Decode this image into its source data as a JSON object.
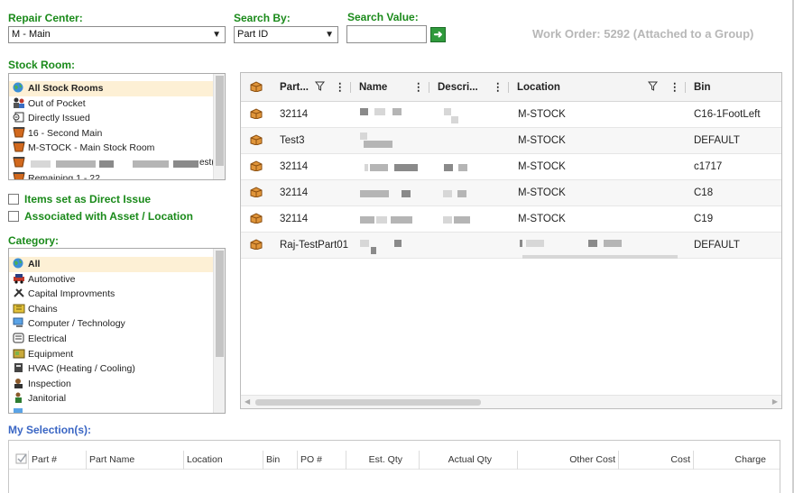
{
  "filters": {
    "repair_center_label": "Repair Center:",
    "repair_center_value": "M - Main",
    "search_by_label": "Search By:",
    "search_by_value": "Part ID",
    "search_value_label": "Search Value:",
    "search_value_input": "",
    "go_icon": "arrow-right-icon"
  },
  "work_order_text": "Work Order: 5292 (Attached to a Group)",
  "stock_room": {
    "label": "Stock Room:",
    "items": [
      {
        "label": "All Stock Rooms",
        "icon": "globe-icon",
        "selected": true
      },
      {
        "label": "Out of Pocket",
        "icon": "people-icon"
      },
      {
        "label": "Directly Issued",
        "icon": "document-icon"
      },
      {
        "label": "16 - Second Main",
        "icon": "bin-icon"
      },
      {
        "label": "M-STOCK - Main Stock Room",
        "icon": "bin-icon"
      },
      {
        "label": "",
        "icon": "bin-icon"
      },
      {
        "label": "Remaining 1 - 22",
        "icon": "bin-icon"
      }
    ],
    "tail_text": "est("
  },
  "options": {
    "direct_issue_label": "Items set as Direct Issue",
    "direct_issue_checked": false,
    "associated_label": "Associated with Asset / Location",
    "associated_checked": false
  },
  "category": {
    "label": "Category:",
    "items": [
      {
        "label": "All",
        "icon": "globe-icon",
        "selected": true
      },
      {
        "label": "Automotive",
        "icon": "car-icon"
      },
      {
        "label": "Capital Improvments",
        "icon": "tools-icon"
      },
      {
        "label": "Chains",
        "icon": "chain-icon"
      },
      {
        "label": "Computer / Technology",
        "icon": "computer-icon"
      },
      {
        "label": "Electrical",
        "icon": "electrical-icon"
      },
      {
        "label": "Equipment",
        "icon": "equipment-icon"
      },
      {
        "label": "HVAC (Heating / Cooling)",
        "icon": "hvac-icon"
      },
      {
        "label": "Inspection",
        "icon": "inspection-icon"
      },
      {
        "label": "Janitorial",
        "icon": "janitorial-icon"
      },
      {
        "label": "",
        "icon": "generic-icon"
      }
    ]
  },
  "grid": {
    "columns": {
      "part": "Part...",
      "name": "Name",
      "description": "Descri...",
      "location": "Location",
      "bin": "Bin"
    },
    "rows": [
      {
        "part": "32114",
        "name": "",
        "description": "",
        "location": "M-STOCK",
        "bin": "C16-1FootLeft"
      },
      {
        "part": "Test3",
        "name": "",
        "description": "",
        "location": "M-STOCK",
        "bin": "DEFAULT"
      },
      {
        "part": "32114",
        "name": "",
        "description": "",
        "location": "M-STOCK",
        "bin": "c1717"
      },
      {
        "part": "32114",
        "name": "",
        "description": "",
        "location": "M-STOCK",
        "bin": "C18"
      },
      {
        "part": "32114",
        "name": "",
        "description": "",
        "location": "M-STOCK",
        "bin": "C19"
      },
      {
        "part": "Raj-TestPart01",
        "name": "",
        "description": "",
        "location": "",
        "bin": "DEFAULT"
      }
    ]
  },
  "selection": {
    "label": "My Selection(s):",
    "columns": [
      "Part #",
      "Part Name",
      "Location",
      "Bin",
      "PO #",
      "Est. Qty",
      "Actual Qty",
      "Other Cost",
      "Cost",
      "Charge"
    ]
  },
  "colors": {
    "label_green": "#1a8a1a",
    "label_blue": "#3a66c4",
    "selected_row": "#fdf0d5",
    "go_button": "#2f9a3c"
  }
}
